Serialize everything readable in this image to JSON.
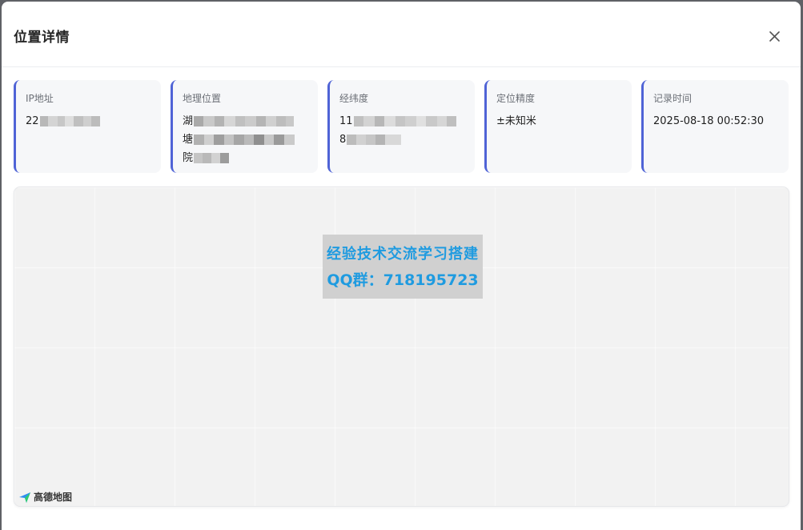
{
  "dialog": {
    "title": "位置详情",
    "close_label": "×"
  },
  "cards": [
    {
      "label": "IP地址",
      "lines": [
        "22"
      ]
    },
    {
      "label": "地理位置",
      "lines": [
        "湖",
        "塘",
        "院"
      ]
    },
    {
      "label": "经纬度",
      "lines": [
        "11",
        "8"
      ]
    },
    {
      "label": "定位精度",
      "lines": [
        "±未知米"
      ]
    },
    {
      "label": "记录时间",
      "lines": [
        "2025-08-18 00:52:30"
      ]
    }
  ],
  "map": {
    "watermark_line1": "经验技术交流学习搭建",
    "watermark_line2": "QQ群：718195723",
    "logo_text": "高德地图"
  },
  "colors": {
    "accent": "#4f63d6",
    "watermark": "#1f9be0"
  },
  "icons": {
    "close": "close-icon",
    "map_logo": "amap-logo-icon"
  }
}
